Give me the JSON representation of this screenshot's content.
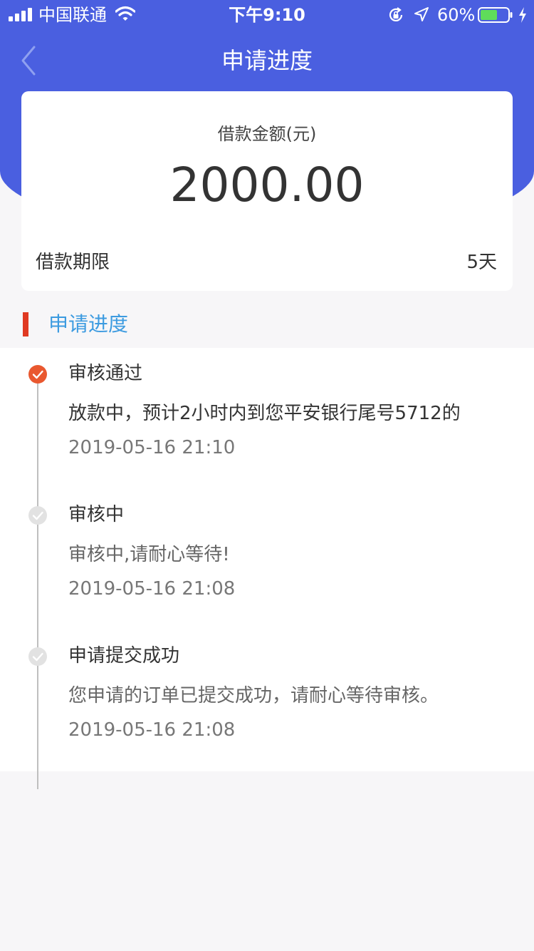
{
  "status_bar": {
    "carrier": "中国联通",
    "time": "下午9:10",
    "battery": "60%"
  },
  "nav": {
    "title": "申请进度"
  },
  "loan": {
    "amount_label": "借款金额(元)",
    "amount": "2000.00",
    "term_label": "借款期限",
    "term_value": "5天"
  },
  "section": {
    "title": "申请进度"
  },
  "timeline": {
    "steps": [
      {
        "title": "审核通过",
        "desc": "放款中，预计2小时内到您平安银行尾号5712的",
        "time": "2019-05-16 21:10"
      },
      {
        "title": "审核中",
        "desc": "审核中,请耐心等待!",
        "time": "2019-05-16 21:08"
      },
      {
        "title": "申请提交成功",
        "desc": "您申请的订单已提交成功，请耐心等待审核。",
        "time": "2019-05-16 21:08"
      }
    ]
  },
  "colors": {
    "header": "#4a5fe0",
    "accent_red": "#e03a22",
    "section_title": "#3d9be0",
    "step_active": "#e9582f",
    "step_inactive": "#e2e2e2"
  }
}
